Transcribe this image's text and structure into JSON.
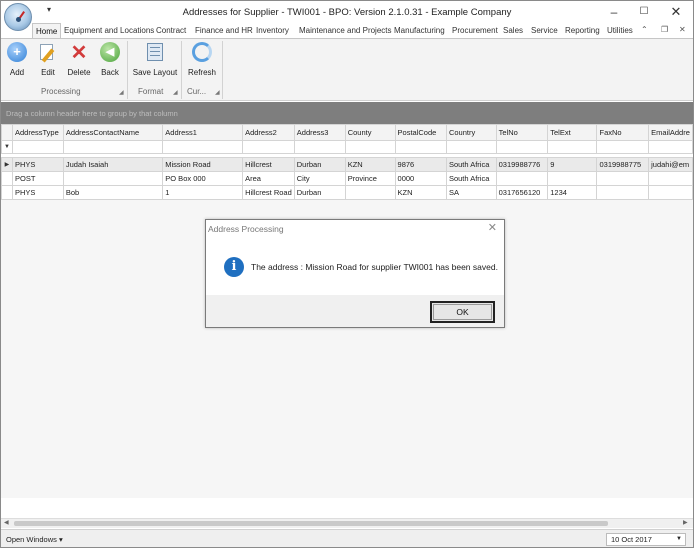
{
  "window": {
    "title": "Addresses for Supplier - TWI001 - BPO: Version 2.1.0.31 - Example Company"
  },
  "tabs": [
    "Home",
    "Equipment and Locations",
    "Contract",
    "Finance and HR",
    "Inventory",
    "Maintenance and Projects",
    "Manufacturing",
    "Procurement",
    "Sales",
    "Service",
    "Reporting",
    "Utilities"
  ],
  "ribbon": {
    "buttons": {
      "add": "Add",
      "edit": "Edit",
      "delete": "Delete",
      "back": "Back",
      "save_layout": "Save Layout",
      "refresh": "Refresh"
    },
    "groups": {
      "processing": "Processing",
      "format": "Format",
      "current": "Cur..."
    }
  },
  "grid": {
    "group_panel_text": "Drag a column header here to group by that column",
    "columns": [
      "AddressType",
      "AddressContactName",
      "Address1",
      "Address2",
      "Address3",
      "County",
      "PostalCode",
      "Country",
      "TelNo",
      "TelExt",
      "FaxNo",
      "EmailAddre"
    ],
    "rows": [
      [
        "PHYS",
        "Judah Isaiah",
        "Mission Road",
        "Hillcrest",
        "Durban",
        "KZN",
        "9876",
        "South Africa",
        "0319988776",
        "9",
        "0319988775",
        "judahi@em"
      ],
      [
        "POST",
        "",
        "PO Box 000",
        "Area",
        "City",
        "Province",
        "0000",
        "South Africa",
        "",
        "",
        "",
        ""
      ],
      [
        "PHYS",
        "Bob",
        "1",
        "Hillcrest Road",
        "Durban",
        "",
        "KZN",
        "SA",
        "0317656120",
        "1234",
        "",
        ""
      ]
    ]
  },
  "status": {
    "open_windows": "Open Windows",
    "date": "10 Oct 2017"
  },
  "dialog": {
    "title": "Address Processing",
    "message": "The address : Mission Road for supplier TWI001 has been saved.",
    "ok_label": "OK"
  },
  "colors": {
    "info_icon": "#1f6fc0",
    "add_icon": "#2f7fd6",
    "delete_icon": "#d23b3b",
    "back_icon": "#4aa33a"
  }
}
